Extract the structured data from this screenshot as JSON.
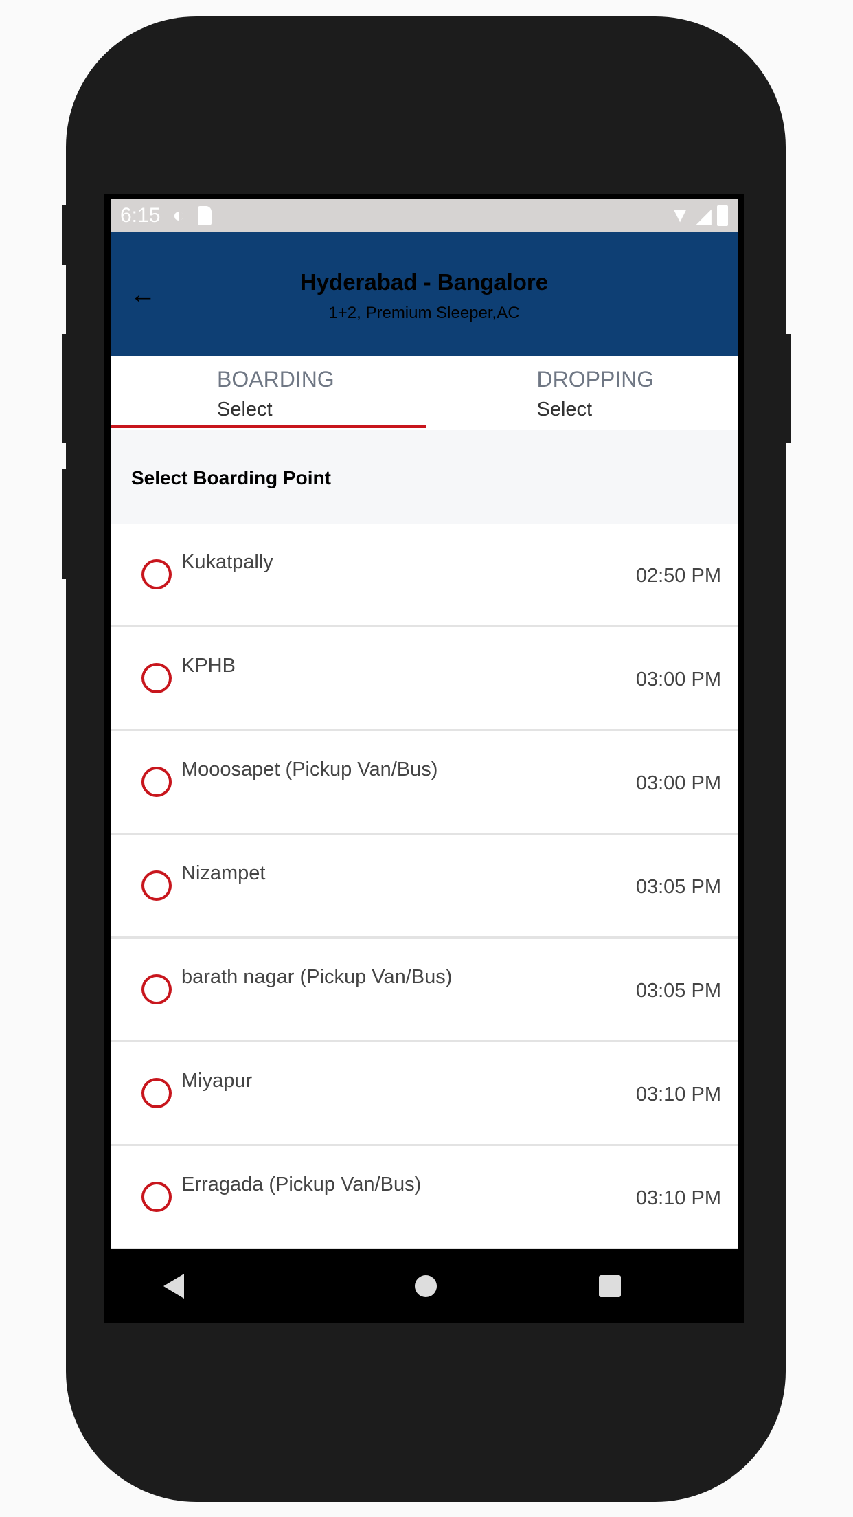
{
  "status_bar": {
    "time": "6:15",
    "icons": [
      "data-saver-icon",
      "sd-card-icon",
      "wifi-icon",
      "signal-icon",
      "battery-icon"
    ]
  },
  "header": {
    "title": "Hyderabad - Bangalore",
    "subtitle": "1+2, Premium Sleeper,AC",
    "back_icon": "arrow-left-icon"
  },
  "tabs": [
    {
      "label": "BOARDING",
      "value": "Select",
      "active": true
    },
    {
      "label": "DROPPING",
      "value": "Select",
      "active": false
    }
  ],
  "section_title": "Select Boarding Point",
  "points": [
    {
      "name": "Kukatpally",
      "time": "02:50 PM"
    },
    {
      "name": "KPHB",
      "time": "03:00 PM"
    },
    {
      "name": "Mooosapet (Pickup Van/Bus)",
      "time": "03:00 PM"
    },
    {
      "name": "Nizampet",
      "time": "03:05 PM"
    },
    {
      "name": "barath nagar (Pickup Van/Bus)",
      "time": "03:05 PM"
    },
    {
      "name": "Miyapur",
      "time": "03:10 PM"
    },
    {
      "name": "Erragada (Pickup Van/Bus)",
      "time": "03:10 PM"
    }
  ],
  "colors": {
    "header": "#0e3f74",
    "accent": "#c8161d",
    "status_bar": "#d6d3d2"
  }
}
